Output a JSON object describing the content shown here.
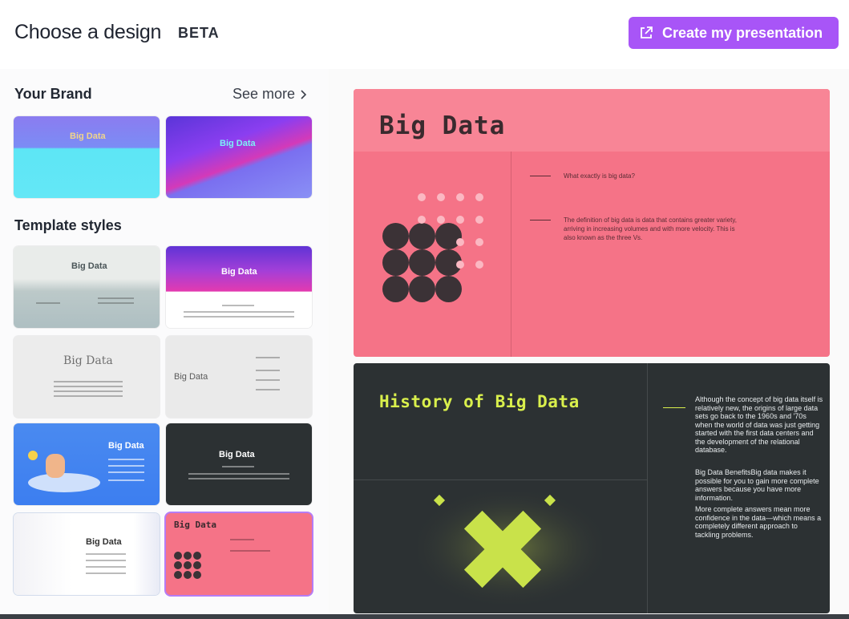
{
  "header": {
    "title": "Choose a design",
    "badge": "BETA",
    "create_label": "Create my presentation",
    "accent": "#a855f7"
  },
  "sidebar": {
    "brand_title": "Your Brand",
    "see_more": "See more",
    "styles_title": "Template styles",
    "brand_thumbs": [
      "Big Data",
      "Big Data"
    ],
    "style_thumbs": [
      "Big Data",
      "Big Data",
      "Big Data",
      "Big Data",
      "Big Data",
      "Big Data",
      "Big Data",
      "Big Data"
    ]
  },
  "preview": {
    "slide1": {
      "title": "Big Data",
      "q1": "What exactly is big data?",
      "q2": "The definition of big data is data that contains greater variety, arriving in increasing volumes and with more velocity. This is also known as the three Vs.",
      "bg": "#f57387"
    },
    "slide2": {
      "title": "History of Big Data",
      "p1": "Although the concept of big data itself is relatively new, the origins of large data sets go back to the 1960s and '70s when the world of data was just getting started with the first data centers and the development of the relational database.",
      "p2": "Big Data BenefitsBig data makes it possible for you to gain more complete answers because you have more information.",
      "p3": "More complete answers mean more confidence in the data—which means a completely different approach to tackling problems.",
      "accent": "#d9ef4c"
    }
  }
}
